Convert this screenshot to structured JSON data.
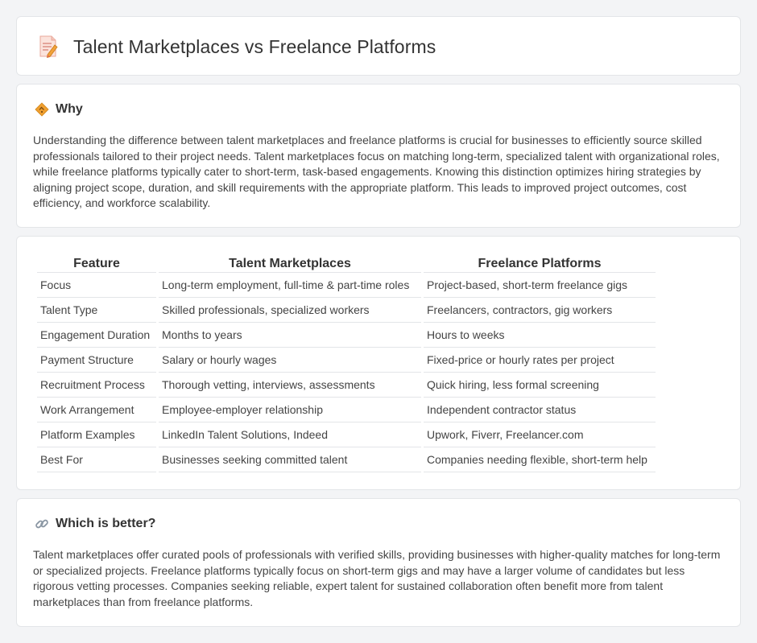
{
  "header": {
    "title": "Talent Marketplaces vs Freelance Platforms",
    "icon": "document-pencil-icon"
  },
  "why": {
    "title": "Why",
    "icon": "diamond-icon",
    "text": "Understanding the difference between talent marketplaces and freelance platforms is crucial for businesses to efficiently source skilled professionals tailored to their project needs. Talent marketplaces focus on matching long-term, specialized talent with organizational roles, while freelance platforms typically cater to short-term, task-based engagements. Knowing this distinction optimizes hiring strategies by aligning project scope, duration, and skill requirements with the appropriate platform. This leads to improved project outcomes, cost efficiency, and workforce scalability."
  },
  "table": {
    "headers": [
      "Feature",
      "Talent Marketplaces",
      "Freelance Platforms"
    ],
    "rows": [
      [
        "Focus",
        "Long-term employment, full-time & part-time roles",
        "Project-based, short-term freelance gigs"
      ],
      [
        "Talent Type",
        "Skilled professionals, specialized workers",
        "Freelancers, contractors, gig workers"
      ],
      [
        "Engagement Duration",
        "Months to years",
        "Hours to weeks"
      ],
      [
        "Payment Structure",
        "Salary or hourly wages",
        "Fixed-price or hourly rates per project"
      ],
      [
        "Recruitment Process",
        "Thorough vetting, interviews, assessments",
        "Quick hiring, less formal screening"
      ],
      [
        "Work Arrangement",
        "Employee-employer relationship",
        "Independent contractor status"
      ],
      [
        "Platform Examples",
        "LinkedIn Talent Solutions, Indeed",
        "Upwork, Fiverr, Freelancer.com"
      ],
      [
        "Best For",
        "Businesses seeking committed talent",
        "Companies needing flexible, short-term help"
      ]
    ]
  },
  "better": {
    "title": "Which is better?",
    "icon": "link-icon",
    "text": "Talent marketplaces offer curated pools of professionals with verified skills, providing businesses with higher-quality matches for long-term or specialized projects. Freelance platforms typically focus on short-term gigs and may have a larger volume of candidates but less rigorous vetting processes. Companies seeking reliable, expert talent for sustained collaboration often benefit more from talent marketplaces than from freelance platforms."
  },
  "colors": {
    "background": "#f3f4f6",
    "card": "#ffffff",
    "border": "#e3e5e8",
    "accent_orange": "#f0a030"
  }
}
